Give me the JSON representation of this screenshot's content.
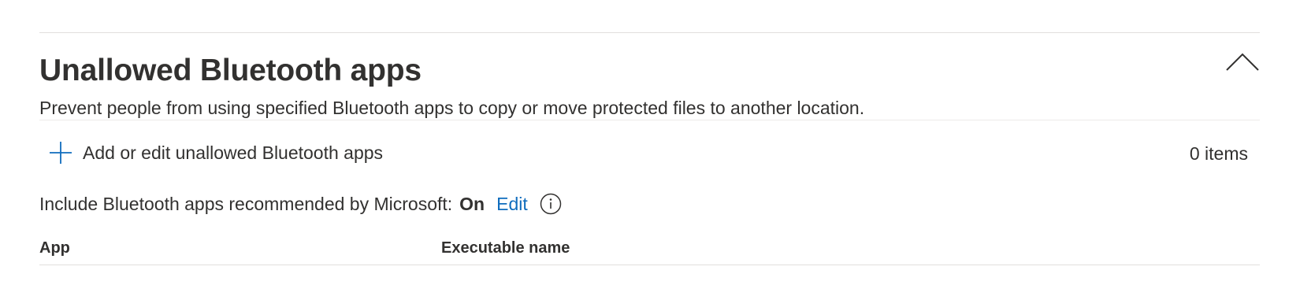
{
  "section": {
    "title": "Unallowed Bluetooth apps",
    "description": "Prevent people from using specified Bluetooth apps to copy or move protected files to another location.",
    "collapse_icon": "chevron-up-icon"
  },
  "toolbar": {
    "add_label": "Add or edit unallowed Bluetooth apps",
    "add_icon": "plus-icon",
    "item_count": "0 items"
  },
  "recommended": {
    "label": "Include Bluetooth apps recommended by Microsoft:",
    "status": "On",
    "edit_label": "Edit",
    "info_icon": "info-icon"
  },
  "table": {
    "columns": [
      {
        "label": "App"
      },
      {
        "label": "Executable name"
      }
    ],
    "rows": []
  },
  "colors": {
    "text": "#323130",
    "accent": "#0f6cbd",
    "divider": "#e1dfdd"
  }
}
